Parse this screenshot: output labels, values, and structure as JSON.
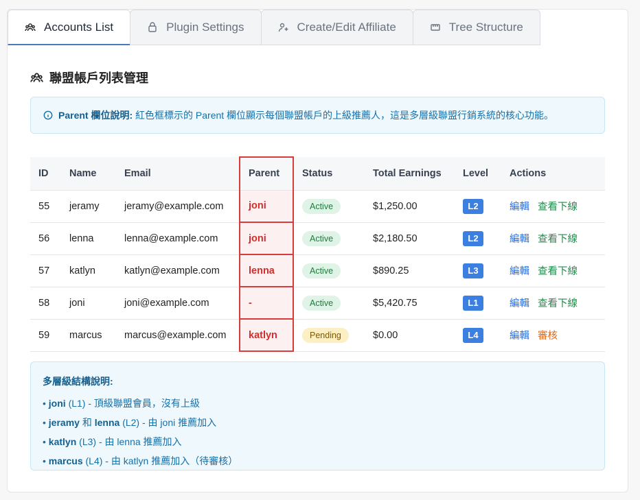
{
  "tabs": [
    {
      "label": "Accounts List",
      "icon": "users-icon",
      "active": true
    },
    {
      "label": "Plugin Settings",
      "icon": "plugin-icon",
      "active": false
    },
    {
      "label": "Create/Edit Affiliate",
      "icon": "user-plus-icon",
      "active": false
    },
    {
      "label": "Tree Structure",
      "icon": "tree-icon",
      "active": false
    }
  ],
  "page_title": "聯盟帳戶列表管理",
  "info": {
    "bold": "Parent 欄位說明:",
    "text": "紅色框標示的 Parent 欄位顯示每個聯盟帳戶的上級推薦人，這是多層級聯盟行銷系統的核心功能。"
  },
  "table": {
    "headers": [
      "ID",
      "Name",
      "Email",
      "Parent",
      "Status",
      "Total Earnings",
      "Level",
      "Actions"
    ],
    "rows": [
      {
        "id": "55",
        "name": "jeramy",
        "email": "jeramy@example.com",
        "parent": "joni",
        "status": "Active",
        "earnings": "$1,250.00",
        "level": "L2",
        "action1": "編輯",
        "action2": "查看下線"
      },
      {
        "id": "56",
        "name": "lenna",
        "email": "lenna@example.com",
        "parent": "joni",
        "status": "Active",
        "earnings": "$2,180.50",
        "level": "L2",
        "action1": "編輯",
        "action2": "查看下線"
      },
      {
        "id": "57",
        "name": "katlyn",
        "email": "katlyn@example.com",
        "parent": "lenna",
        "status": "Active",
        "earnings": "$890.25",
        "level": "L3",
        "action1": "編輯",
        "action2": "查看下線"
      },
      {
        "id": "58",
        "name": "joni",
        "email": "joni@example.com",
        "parent": "-",
        "status": "Active",
        "earnings": "$5,420.75",
        "level": "L1",
        "action1": "編輯",
        "action2": "查看下線"
      },
      {
        "id": "59",
        "name": "marcus",
        "email": "marcus@example.com",
        "parent": "katlyn",
        "status": "Pending",
        "earnings": "$0.00",
        "level": "L4",
        "action1": "編輯",
        "action2": "審核"
      }
    ]
  },
  "note": {
    "title": "多層級結構說明:",
    "items": [
      {
        "bold": "joni",
        "text": " (L1) - 頂級聯盟會員，沒有上級"
      },
      {
        "bold": "jeramy",
        "mid": " 和 ",
        "bold2": "lenna",
        "text": " (L2) - 由 joni 推薦加入"
      },
      {
        "bold": "katlyn",
        "text": " (L3) - 由 lenna 推薦加入"
      },
      {
        "bold": "marcus",
        "text": " (L4) - 由 katlyn 推薦加入（待審核）"
      }
    ]
  },
  "colors": {
    "accent": "#4a79b7",
    "parent_border": "#d93a3a",
    "level_badge": "#3b7fe0"
  }
}
